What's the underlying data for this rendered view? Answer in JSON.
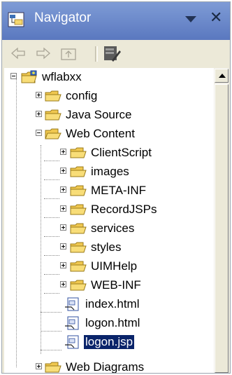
{
  "view": {
    "title": "Navigator",
    "menu_icon": "view-menu-triangle-icon",
    "close_icon": "close-icon"
  },
  "toolbar": {
    "back_icon": "back-arrow-icon",
    "forward_icon": "forward-arrow-icon",
    "up_icon": "up-folder-icon",
    "menu_icon": "toolbar-menu-icon"
  },
  "tree": {
    "project": {
      "label": "wflabxx",
      "icon": "project-folder-icon"
    },
    "children": [
      {
        "label": "config",
        "icon": "folder-icon",
        "expanded": false
      },
      {
        "label": "Java Source",
        "icon": "folder-icon",
        "expanded": false
      },
      {
        "label": "Web Content",
        "icon": "folder-open-icon",
        "expanded": true
      },
      {
        "label": "Web Diagrams",
        "icon": "folder-icon",
        "expanded": false
      }
    ],
    "web_content": [
      {
        "label": "ClientScript",
        "icon": "folder-icon"
      },
      {
        "label": "images",
        "icon": "folder-icon"
      },
      {
        "label": "META-INF",
        "icon": "folder-icon"
      },
      {
        "label": "RecordJSPs",
        "icon": "folder-icon"
      },
      {
        "label": "services",
        "icon": "folder-icon"
      },
      {
        "label": "styles",
        "icon": "folder-icon"
      },
      {
        "label": "UIMHelp",
        "icon": "folder-icon"
      },
      {
        "label": "WEB-INF",
        "icon": "folder-icon"
      },
      {
        "label": "index.html",
        "icon": "file-icon"
      },
      {
        "label": "logon.html",
        "icon": "file-icon"
      },
      {
        "label": "logon.jsp",
        "icon": "file-icon",
        "selected": true
      }
    ]
  },
  "colors": {
    "title_bar": "#6b88c8",
    "selection": "#0a246a",
    "folder": "#f5d76e"
  }
}
